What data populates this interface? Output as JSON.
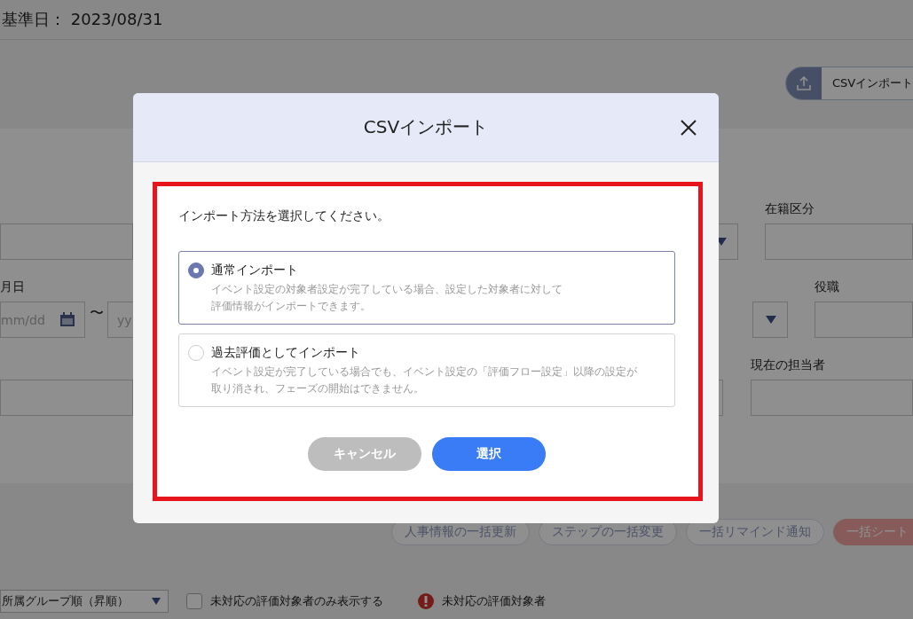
{
  "header": {
    "base_date": "基準日： 2023/08/31"
  },
  "csv_import_button": {
    "label": "CSVインポート"
  },
  "filters": {
    "status_label": "在籍区分",
    "date_label": "月日",
    "date_from_placeholder": "mm/dd",
    "range_separator": "〜",
    "date_to_placeholder": "yy",
    "position_label": "役職",
    "assignee_label": "現在の担当者"
  },
  "bulk_actions": [
    {
      "label": "人事情報の一括更新",
      "kind": "outline"
    },
    {
      "label": "ステップの一括変更",
      "kind": "outline"
    },
    {
      "label": "一括リマインド通知",
      "kind": "outline"
    },
    {
      "label": "一括シート",
      "kind": "danger"
    }
  ],
  "list_controls": {
    "sort": "所属グループ順（昇順）",
    "unhandled_only": {
      "label": "未対応の評価対象者のみ表示する",
      "checked": false
    },
    "legend": "未対応の評価対象者"
  },
  "dialog": {
    "title": "CSVインポート",
    "highlighted": true,
    "prompt": "インポート方法を選択してください。",
    "options": [
      {
        "label": "通常インポート",
        "description_lines": [
          "イベント設定の対象者設定が完了している場合、設定した対象者に対して",
          "評価情報がインポートできます。"
        ],
        "selected": true
      },
      {
        "label": "過去評価としてインポート",
        "description_lines": [
          "イベント設定が完了している場合でも、イベント設定の「評価フロー設定」以降の設定が",
          "取り消され、フェーズの開始はできません。"
        ],
        "selected": false
      }
    ],
    "buttons": [
      {
        "label": "キャンセル",
        "kind": "cancel"
      },
      {
        "label": "選択",
        "kind": "primary"
      }
    ]
  }
}
